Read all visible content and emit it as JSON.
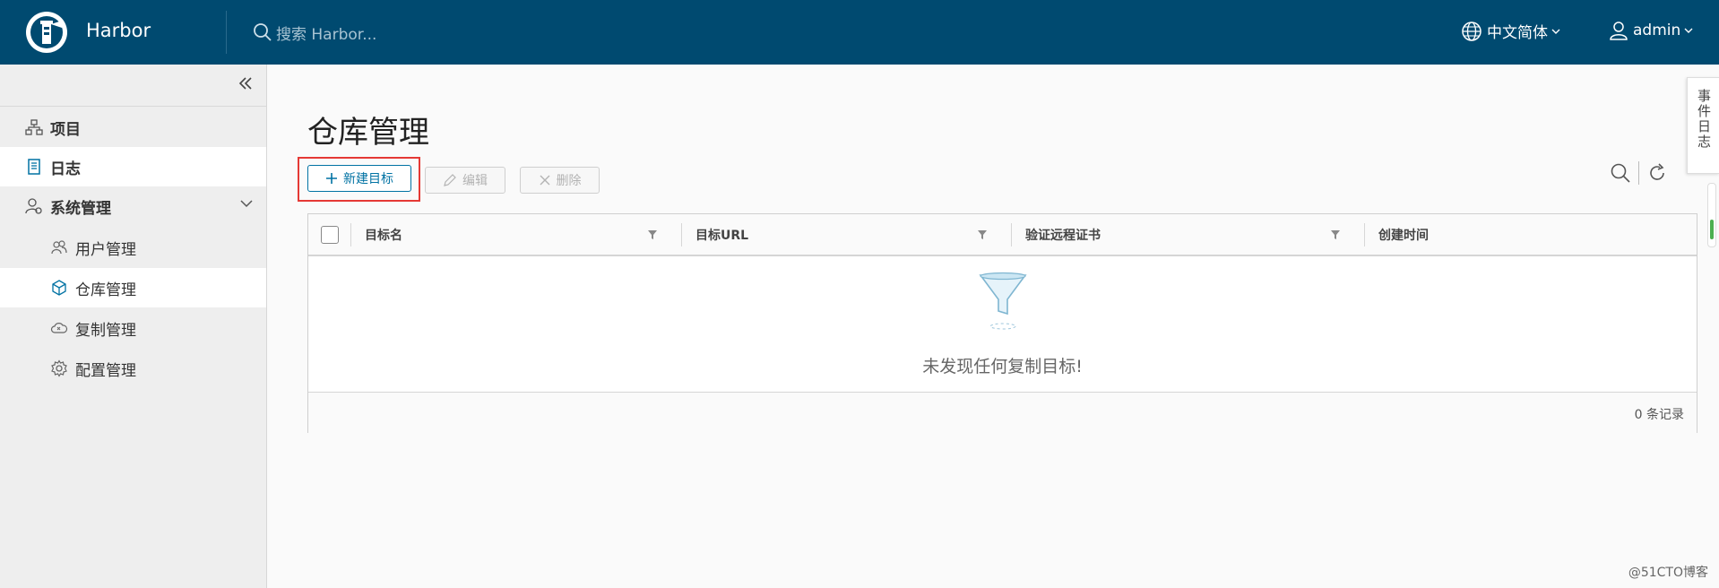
{
  "header": {
    "brand": "Harbor",
    "search_placeholder": "搜索 Harbor...",
    "language": "中文简体",
    "user": "admin"
  },
  "sidebar": {
    "items": [
      {
        "label": "项目",
        "icon": "org-chart-icon"
      },
      {
        "label": "日志",
        "icon": "document-icon"
      },
      {
        "label": "系统管理",
        "icon": "user-settings-icon"
      },
      {
        "label": "用户管理",
        "icon": "users-icon"
      },
      {
        "label": "仓库管理",
        "icon": "cube-icon"
      },
      {
        "label": "复制管理",
        "icon": "cloud-sync-icon"
      },
      {
        "label": "配置管理",
        "icon": "gear-icon"
      }
    ]
  },
  "main": {
    "title": "仓库管理",
    "toolbar": {
      "new_label": "新建目标",
      "edit_label": "编辑",
      "delete_label": "删除"
    },
    "table": {
      "columns": [
        "目标名",
        "目标URL",
        "验证远程证书",
        "创建时间"
      ],
      "empty_text": "未发现任何复制目标!",
      "record_count": "0 条记录"
    }
  },
  "event_tab": "事件日志",
  "watermark": "@51CTO博客",
  "colors": {
    "header_bg": "#004a70",
    "accent": "#0072a3",
    "highlight_box": "#e53935"
  }
}
